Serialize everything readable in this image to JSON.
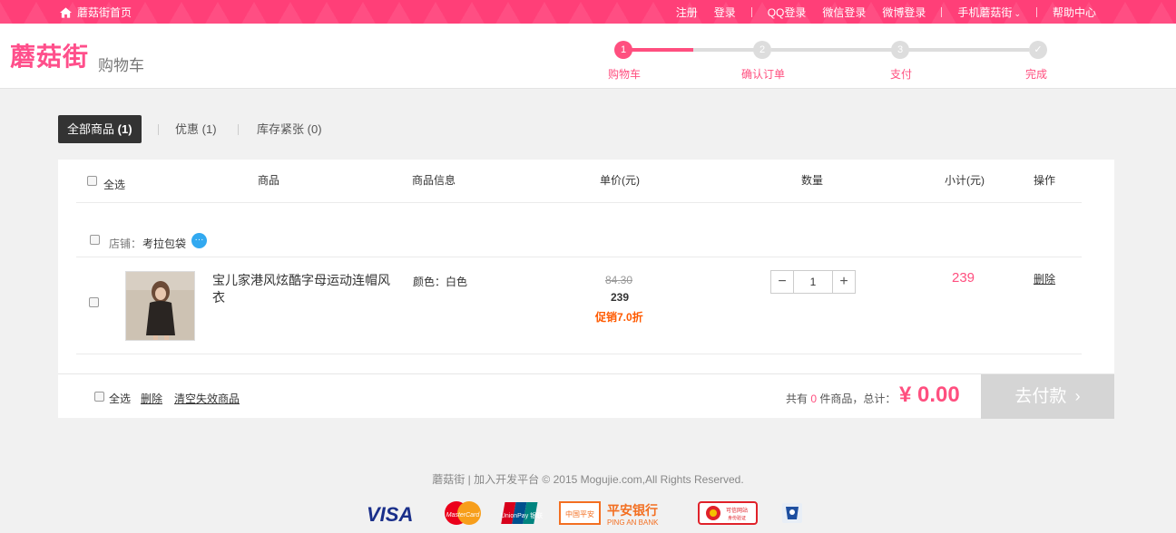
{
  "topbar": {
    "home": "蘑菇街首页",
    "links": [
      "注册",
      "登录",
      "QQ登录",
      "微信登录",
      "微博登录",
      "手机蘑菇街",
      "帮助中心"
    ]
  },
  "header": {
    "logo": "蘑菇街",
    "subtitle": "购物车",
    "steps": [
      {
        "num": "1",
        "label": "购物车"
      },
      {
        "num": "2",
        "label": "确认订单"
      },
      {
        "num": "3",
        "label": "支付"
      },
      {
        "num": "✓",
        "label": "完成"
      }
    ]
  },
  "tabs": {
    "all_label": "全部商品",
    "all_count": "(1)",
    "discount_label": "优惠",
    "discount_count": "(1)",
    "stock_label": "库存紧张",
    "stock_count": "(0)"
  },
  "table": {
    "select_all": "全选",
    "col_product": "商品",
    "col_info": "商品信息",
    "col_price": "单价(元)",
    "col_qty": "数量",
    "col_subtotal": "小计(元)",
    "col_action": "操作"
  },
  "shop": {
    "prefix": "店铺：",
    "name": "考拉包袋"
  },
  "item": {
    "title": "宝儿家港风炫酷字母运动连帽风衣",
    "attr": "颜色：白色",
    "original_price": "84.30",
    "price": "239",
    "promo": "促销7.0折",
    "quantity": "1",
    "subtotal": "239",
    "delete": "删除"
  },
  "footer_bar": {
    "select_all": "全选",
    "delete": "删除",
    "clear_invalid": "清空失效商品",
    "count_prefix": "共有",
    "count": "0",
    "count_suffix": "件商品，总计：",
    "total": "¥ 0.00",
    "pay_button": "去付款",
    "pay_arrow": "›"
  },
  "page_footer": {
    "copyright": "蘑菇街 | 加入开发平台  © 2015 Mogujie.com,All Rights Reserved."
  },
  "payment_logos": [
    "VISA",
    "MasterCard",
    "UnionPay 银联",
    "中国平安",
    "平安银行",
    "PING AN BANK",
    "可信网站",
    "身份验证"
  ],
  "colors": {
    "brand": "#ff4f7f",
    "promo": "#ff5a00",
    "topbar": "#ff3f78"
  }
}
